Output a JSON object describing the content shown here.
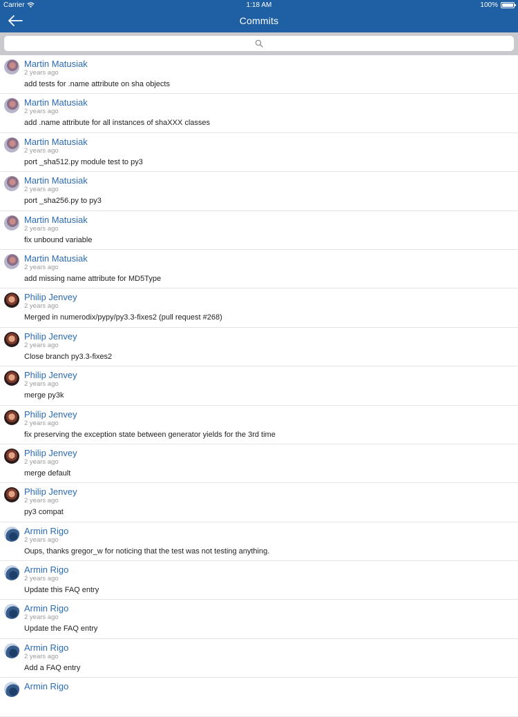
{
  "status_bar": {
    "carrier": "Carrier",
    "time": "1:18 AM",
    "battery": "100%"
  },
  "nav": {
    "title": "Commits",
    "back_icon": "arrow-left-icon"
  },
  "search": {
    "placeholder": "",
    "icon": "search-icon"
  },
  "colors": {
    "nav_bg": "#1f5fa3",
    "author": "#2b6bb3",
    "search_bg": "#c9c9ce"
  },
  "commits": [
    {
      "author": "Martin Matusiak",
      "time": "2 years ago",
      "message": "add tests for .name attribute on sha objects",
      "avatar": "martin"
    },
    {
      "author": "Martin Matusiak",
      "time": "2 years ago",
      "message": "add .name attribute for all instances of shaXXX classes",
      "avatar": "martin"
    },
    {
      "author": "Martin Matusiak",
      "time": "2 years ago",
      "message": "port _sha512.py module test to py3",
      "avatar": "martin"
    },
    {
      "author": "Martin Matusiak",
      "time": "2 years ago",
      "message": "port _sha256.py to py3",
      "avatar": "martin"
    },
    {
      "author": "Martin Matusiak",
      "time": "2 years ago",
      "message": "fix unbound variable",
      "avatar": "martin"
    },
    {
      "author": "Martin Matusiak",
      "time": "2 years ago",
      "message": "add missing name attribute for MD5Type",
      "avatar": "martin"
    },
    {
      "author": "Philip Jenvey",
      "time": "2 years ago",
      "message": "Merged in numerodix/pypy/py3.3-fixes2 (pull request #268)",
      "avatar": "philip"
    },
    {
      "author": "Philip Jenvey",
      "time": "2 years ago",
      "message": "Close branch py3.3-fixes2",
      "avatar": "philip"
    },
    {
      "author": "Philip Jenvey",
      "time": "2 years ago",
      "message": "merge py3k",
      "avatar": "philip"
    },
    {
      "author": "Philip Jenvey",
      "time": "2 years ago",
      "message": "fix preserving the exception state between generator yields for the 3rd time",
      "avatar": "philip"
    },
    {
      "author": "Philip Jenvey",
      "time": "2 years ago",
      "message": "merge default",
      "avatar": "philip"
    },
    {
      "author": "Philip Jenvey",
      "time": "2 years ago",
      "message": "py3 compat",
      "avatar": "philip"
    },
    {
      "author": "Armin Rigo",
      "time": "2 years ago",
      "message": "Oups, thanks gregor_w for noticing that the test was not testing anything.",
      "avatar": "armin"
    },
    {
      "author": "Armin Rigo",
      "time": "2 years ago",
      "message": "Update this FAQ entry",
      "avatar": "armin"
    },
    {
      "author": "Armin Rigo",
      "time": "2 years ago",
      "message": "Update the FAQ entry",
      "avatar": "armin"
    },
    {
      "author": "Armin Rigo",
      "time": "2 years ago",
      "message": "Add a FAQ entry",
      "avatar": "armin"
    },
    {
      "author": "Armin Rigo",
      "time": "",
      "message": "",
      "avatar": "armin"
    }
  ]
}
